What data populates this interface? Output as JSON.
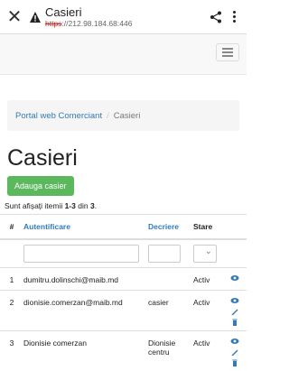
{
  "browser": {
    "site_title": "Casieri",
    "url_scheme": "https",
    "url_rest": "://212.98.184.68:446"
  },
  "breadcrumb": {
    "home": "Portal web Comerciant",
    "separator": "/",
    "current": "Casieri"
  },
  "page": {
    "title": "Casieri",
    "add_button": "Adauga casier",
    "summary_prefix": "Sunt afișați itemii ",
    "summary_range": "1-3",
    "summary_mid": " din ",
    "summary_total": "3",
    "summary_suffix": "."
  },
  "table": {
    "headers": {
      "num": "#",
      "auth": "Autentificare",
      "desc": "Decriere",
      "state": "Stare"
    },
    "rows": [
      {
        "num": "1",
        "auth": "dumitru.dolinschi@maib.md",
        "desc": "",
        "state": "Activ"
      },
      {
        "num": "2",
        "auth": "dionisie.comerzan@maib.md",
        "desc": "casier",
        "state": "Activ"
      },
      {
        "num": "3",
        "auth": "Dionisie comerzan",
        "desc": "Dionisie centru",
        "state": "Activ"
      }
    ]
  },
  "colors": {
    "link": "#337ab7",
    "success": "#5cb85c"
  },
  "icons": [
    "close-icon",
    "warning-icon",
    "share-icon",
    "more-icon",
    "menu-icon",
    "view-icon",
    "edit-icon",
    "delete-icon"
  ]
}
